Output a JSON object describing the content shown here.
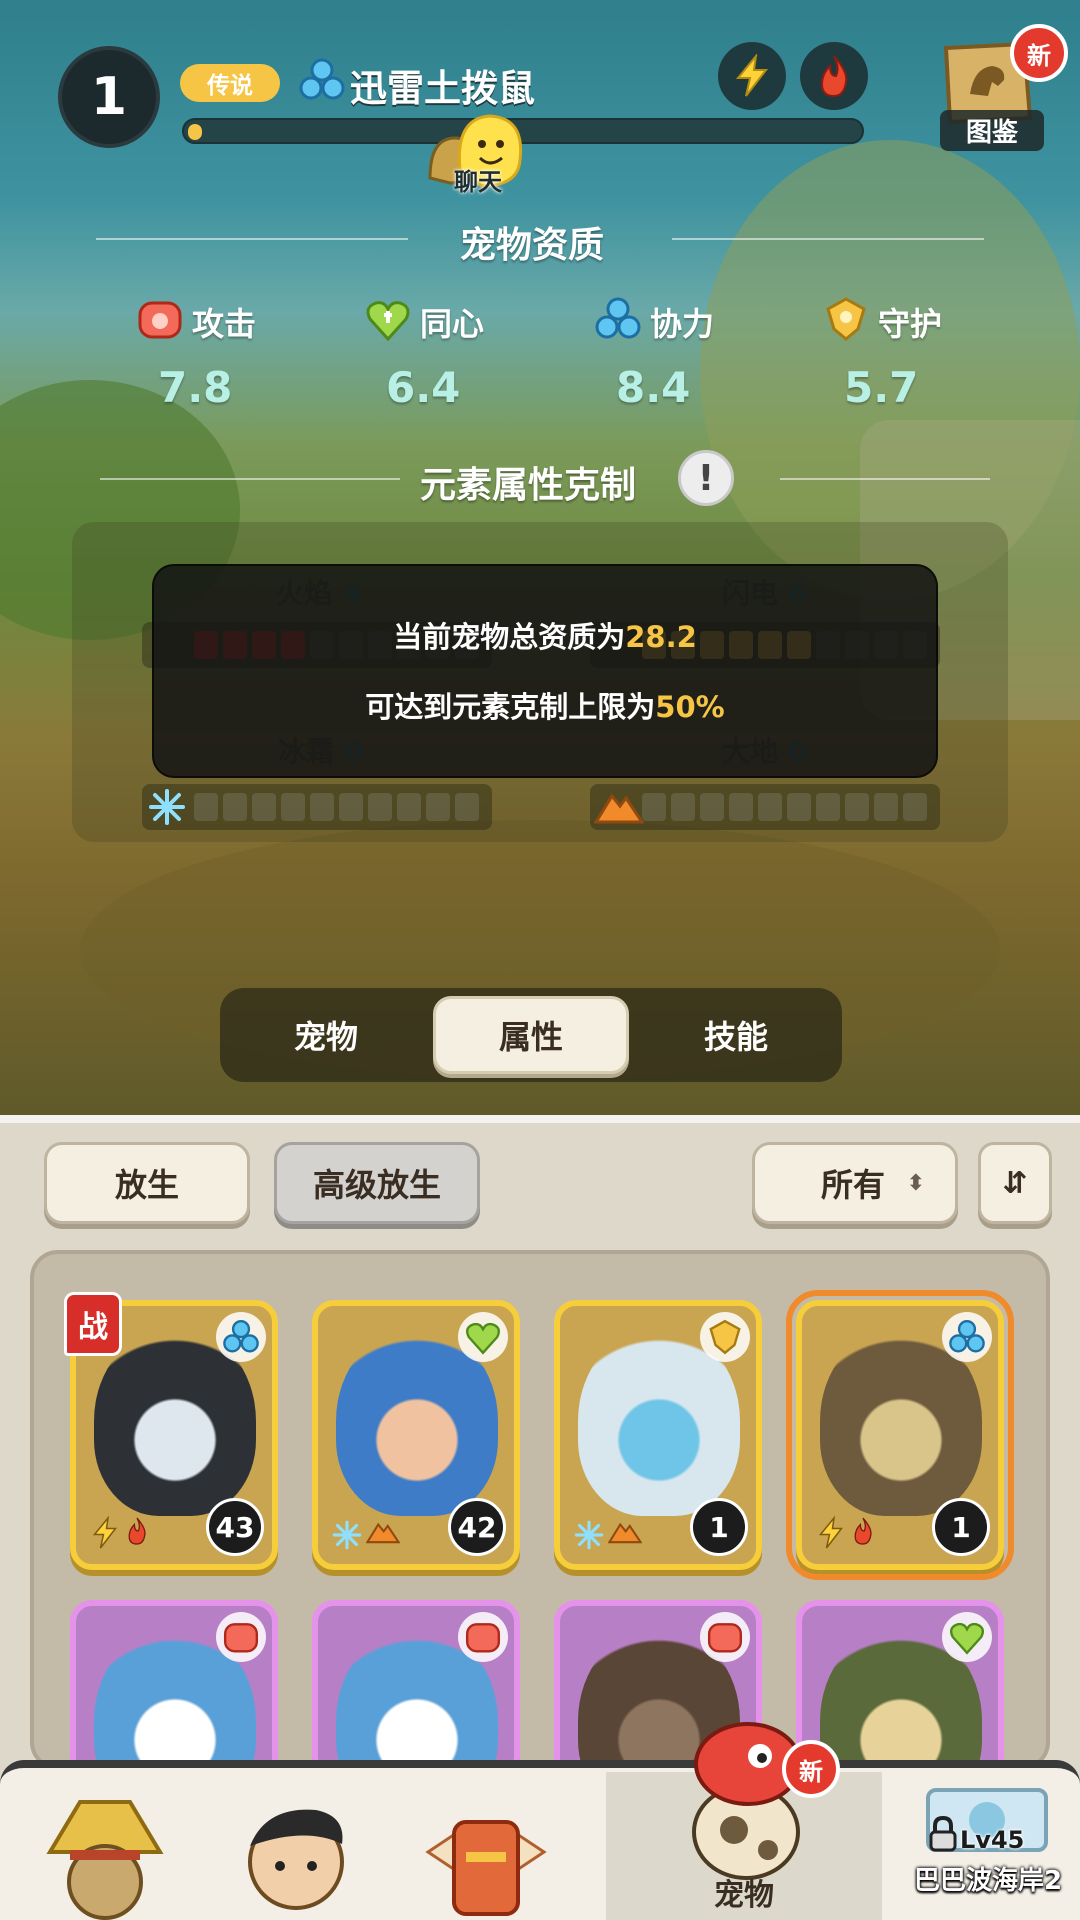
{
  "header": {
    "level": "1",
    "rarity": "传说",
    "pet_name": "迅雷土拨鼠",
    "xp_fraction": 0.01,
    "chat_label": "聊天",
    "codex_label": "图鉴",
    "new_badge": "新",
    "element_icons": [
      "lightning-icon",
      "fire-icon"
    ]
  },
  "aptitude": {
    "title": "宠物资质",
    "stats": [
      {
        "label": "攻击",
        "value": "7.8",
        "icon": "attack-icon"
      },
      {
        "label": "同心",
        "value": "6.4",
        "icon": "heart-icon"
      },
      {
        "label": "协力",
        "value": "8.4",
        "icon": "synergy-icon"
      },
      {
        "label": "守护",
        "value": "5.7",
        "icon": "guard-icon"
      }
    ]
  },
  "elements": {
    "title": "元素属性克制",
    "info_icon": "!",
    "fire": {
      "label": "火焰",
      "value": "4",
      "filled": 4
    },
    "lightning": {
      "label": "闪电",
      "value": "6",
      "filled": 6
    },
    "frost": {
      "label": "冰霜",
      "value": "0",
      "filled": 0
    },
    "earth": {
      "label": "大地",
      "value": "0",
      "filled": 0
    }
  },
  "tooltip": {
    "line1_prefix": "当前宠物总资质为",
    "line1_value": "28.2",
    "line2_prefix": "可达到元素克制上限为",
    "line2_value": "50%"
  },
  "tabs": [
    {
      "label": "宠物",
      "active": false
    },
    {
      "label": "属性",
      "active": true
    },
    {
      "label": "技能",
      "active": false
    }
  ],
  "toolbar": {
    "release": "放生",
    "advanced_release": "高级放生",
    "filter": "所有",
    "sort_icon": "sort-icon"
  },
  "pets": [
    {
      "type": "synergy",
      "level": "43",
      "battle": "战",
      "rarity": "gold",
      "colors": [
        "#2d3136",
        "#dfe7ee"
      ]
    },
    {
      "type": "heart",
      "level": "42",
      "rarity": "gold",
      "colors": [
        "#3f7cc8",
        "#f1c2a0"
      ]
    },
    {
      "type": "guard",
      "level": "1",
      "rarity": "gold",
      "colors": [
        "#d8e6ee",
        "#6fc5e8"
      ]
    },
    {
      "type": "synergy",
      "level": "1",
      "rarity": "gold",
      "selected": true,
      "colors": [
        "#6e5a3c",
        "#d9c58a"
      ]
    },
    {
      "type": "attack",
      "rarity": "purple",
      "colors": [
        "#5aa0d8",
        "#ffffff"
      ]
    },
    {
      "type": "attack",
      "rarity": "purple",
      "colors": [
        "#5aa0d8",
        "#ffffff"
      ]
    },
    {
      "type": "attack",
      "rarity": "purple",
      "colors": [
        "#5a4636",
        "#8e7560"
      ]
    },
    {
      "type": "heart",
      "rarity": "purple",
      "colors": [
        "#5a6a3a",
        "#e7d39a"
      ]
    }
  ],
  "nav": {
    "items": [
      {
        "label": "",
        "icon": "straw-hat-character-icon"
      },
      {
        "label": "",
        "icon": "trainer-character-icon"
      },
      {
        "label": "",
        "icon": "totem-character-icon"
      },
      {
        "label": "宠物",
        "icon": "pet-dino-icon",
        "active": true
      }
    ],
    "new_badge": "新",
    "map_level": "Lv45",
    "map_name": "巴巴波海岸2"
  },
  "colors": {
    "accent": "#f6c545",
    "stat_value": "#b8f0e6",
    "gold_card": "#f6cd3a",
    "purple_card": "#e592ea",
    "badge_red": "#e43a2e"
  }
}
